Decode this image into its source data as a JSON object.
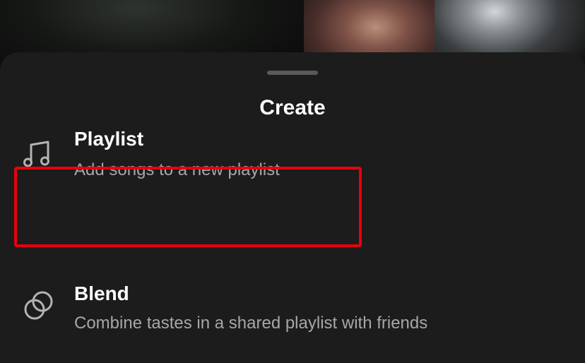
{
  "header": {
    "title": "Create"
  },
  "options": [
    {
      "title": "Playlist",
      "subtitle": "Add songs to a new playlist",
      "icon": "music-note-icon"
    },
    {
      "title": "Blend",
      "subtitle": "Combine tastes in a shared playlist with friends",
      "icon": "blend-circles-icon"
    }
  ],
  "colors": {
    "sheet_background": "#1c1c1c",
    "highlight": "#e8000d",
    "subtitle_text": "#a7a7a7",
    "title_text": "#ffffff"
  }
}
